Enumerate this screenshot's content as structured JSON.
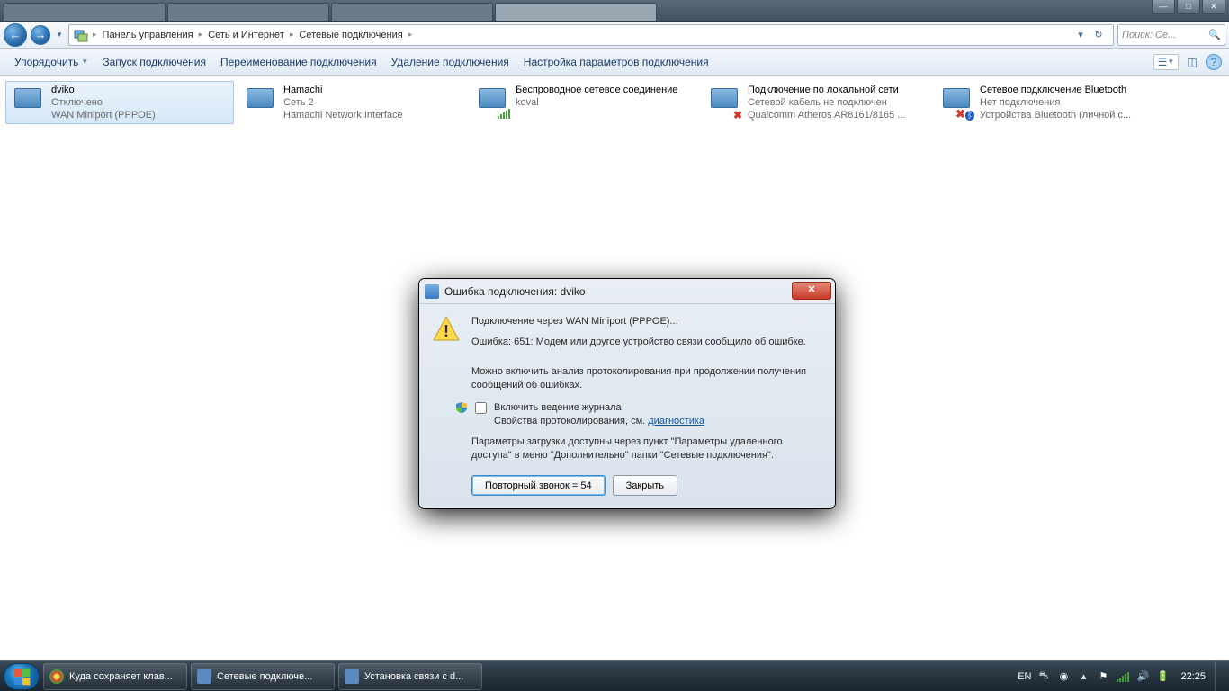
{
  "window": {
    "minimize": "—",
    "maximize": "□",
    "close": "✕"
  },
  "browserTabs": [
    "",
    "",
    "",
    ""
  ],
  "nav": {
    "back": "←",
    "forward": "→",
    "breadcrumb": [
      "Панель управления",
      "Сеть и Интернет",
      "Сетевые подключения"
    ],
    "refresh": "↻",
    "searchPlaceholder": "Поиск: Се..."
  },
  "toolbar": {
    "items": [
      "Упорядочить",
      "Запуск подключения",
      "Переименование подключения",
      "Удаление подключения",
      "Настройка параметров подключения"
    ],
    "hasDropdown": [
      true,
      false,
      false,
      false,
      false
    ]
  },
  "connections": [
    {
      "name": "dviko",
      "status": "Отключено",
      "device": "WAN Miniport (PPPOE)",
      "overlay": "",
      "selected": true
    },
    {
      "name": "Hamachi",
      "status": "Сеть 2",
      "device": "Hamachi Network Interface",
      "overlay": "",
      "selected": false
    },
    {
      "name": "Беспроводное сетевое соединение",
      "status": "koval",
      "device": "",
      "overlay": "bars",
      "selected": false
    },
    {
      "name": "Подключение по локальной сети",
      "status": "Сетевой кабель не подключен",
      "device": "Qualcomm Atheros AR8161/8165 ...",
      "overlay": "x",
      "selected": false
    },
    {
      "name": "Сетевое подключение Bluetooth",
      "status": "Нет подключения",
      "device": "Устройства Bluetooth (личной с...",
      "overlay": "x-bt",
      "selected": false
    }
  ],
  "dialog": {
    "title": "Ошибка подключения: dviko",
    "close": "✕",
    "line1": "Подключение через WAN Miniport (PPPOE)...",
    "line2": "Ошибка: 651: Модем или другое устройство связи сообщило об ошибке.",
    "line3": "Можно включить анализ протоколирования при продолжении получения сообщений об ошибках.",
    "checkbox": "Включить ведение журнала",
    "logHint": "Свойства протоколирования, см. ",
    "logLink": "диагностика",
    "footer": "Параметры загрузки доступны через пункт \"Параметры удаленного доступа\" в меню \"Дополнительно\" папки \"Сетевые подключения\".",
    "retry": "Повторный звонок = 54",
    "closeBtn": "Закрыть"
  },
  "taskbar": {
    "items": [
      "Куда сохраняет клав...",
      "Сетевые подключе...",
      "Установка связи с d..."
    ],
    "lang": "EN",
    "time": "22:25"
  }
}
